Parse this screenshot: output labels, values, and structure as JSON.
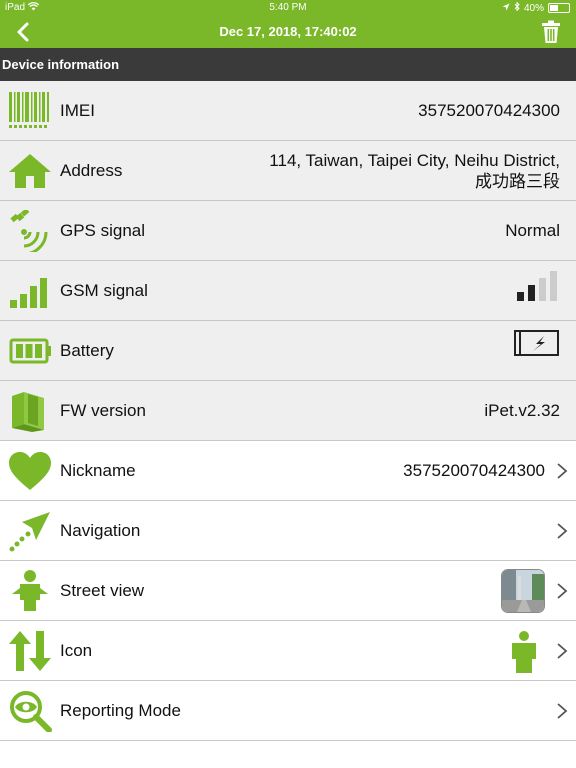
{
  "status_bar": {
    "device": "iPad",
    "time": "5:40 PM",
    "battery": "40%"
  },
  "nav": {
    "title": "Dec 17, 2018, 17:40:02"
  },
  "section": {
    "title": "Device information"
  },
  "rows": {
    "imei": {
      "label": "IMEI",
      "value": "357520070424300"
    },
    "address": {
      "label": "Address",
      "value_line1": "114, Taiwan, Taipei City, Neihu District,",
      "value_line2": "成功路三段"
    },
    "gps": {
      "label": "GPS signal",
      "value": "Normal"
    },
    "gsm": {
      "label": "GSM signal",
      "bars_filled": 2,
      "bars_total": 4
    },
    "battery": {
      "label": "Battery",
      "state": "charging"
    },
    "fw": {
      "label": "FW version",
      "value": "iPet.v2.32"
    },
    "nickname": {
      "label": "Nickname",
      "value": "357520070424300"
    },
    "navigation": {
      "label": "Navigation"
    },
    "street_view": {
      "label": "Street view"
    },
    "icon": {
      "label": "Icon"
    },
    "reporting_mode": {
      "label": "Reporting Mode"
    }
  },
  "colors": {
    "accent": "#7ab82a",
    "header_dark": "#3a3a3a",
    "row_gray": "#efefef"
  },
  "icons": {
    "imei": "barcode-icon",
    "address": "home-icon",
    "gps": "satellite-icon",
    "gsm": "signal-bars-icon",
    "battery": "battery-icon",
    "fw": "books-icon",
    "nickname": "heart-icon",
    "navigation": "navigation-arrow-icon",
    "street_view": "person-icon",
    "icon": "up-down-arrows-icon",
    "reporting_mode": "magnifier-eye-icon"
  }
}
